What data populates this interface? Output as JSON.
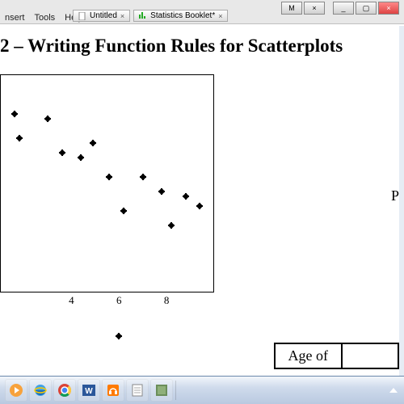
{
  "menu": {
    "items": [
      "nsert",
      "Tools",
      "Help"
    ]
  },
  "tabs": [
    {
      "label": "Untitled",
      "icon": "doc"
    },
    {
      "label": "Statistics Booklet*",
      "icon": "stats"
    }
  ],
  "window": {
    "box_m": "M",
    "box_x": "×",
    "min": "_",
    "max": "▢",
    "close": "×"
  },
  "heading": "2 – Writing Function Rules for Scatterplots",
  "chart_data": {
    "type": "scatter",
    "xlabel": "",
    "ylabel": "",
    "xticks": [
      4,
      6,
      8
    ],
    "xlim": [
      1,
      10
    ],
    "ylim": [
      0,
      90
    ],
    "points": [
      {
        "x": 1.6,
        "y": 74
      },
      {
        "x": 1.8,
        "y": 64
      },
      {
        "x": 3.0,
        "y": 72
      },
      {
        "x": 3.6,
        "y": 58
      },
      {
        "x": 4.4,
        "y": 56
      },
      {
        "x": 4.9,
        "y": 62
      },
      {
        "x": 5.6,
        "y": 48
      },
      {
        "x": 6.2,
        "y": 34
      },
      {
        "x": 7.0,
        "y": 48
      },
      {
        "x": 7.8,
        "y": 42
      },
      {
        "x": 8.2,
        "y": 28
      },
      {
        "x": 8.8,
        "y": 40
      },
      {
        "x": 9.4,
        "y": 36
      }
    ],
    "stray_point": {
      "x": 6.0,
      "y": -5
    }
  },
  "table": {
    "r1c1": "Age of",
    "r1c2": ""
  },
  "right_edge_letter": "P",
  "taskbar": {
    "icons": [
      "media-player",
      "internet-explorer",
      "chrome",
      "word",
      "headphones",
      "notepad",
      "app-green"
    ]
  }
}
